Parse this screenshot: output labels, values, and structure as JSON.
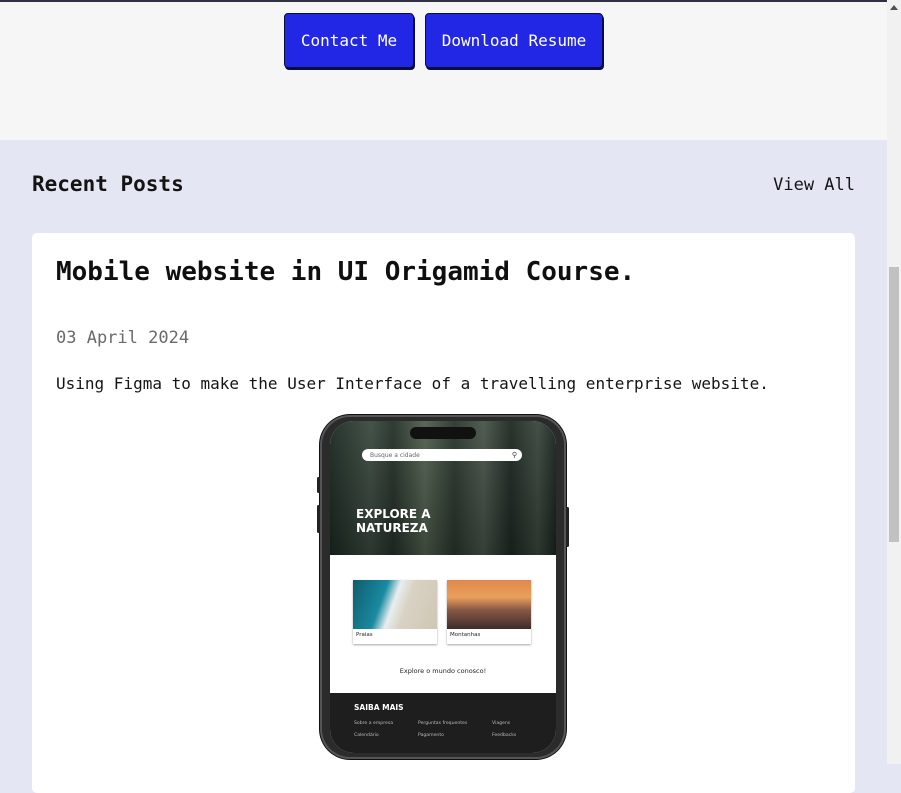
{
  "hero": {
    "contact_label": "Contact Me",
    "resume_label": "Download Resume"
  },
  "recent_posts": {
    "title": "Recent Posts",
    "view_all_label": "View All"
  },
  "post": {
    "title": "Mobile website in UI Origamid Course.",
    "date": "03 April 2024",
    "description": "Using Figma to make the User Interface of a travelling enterprise website.",
    "mockup": {
      "search_placeholder": "Busque a cidade",
      "hero_title": "EXPLORE A NATUREZA",
      "cards": [
        {
          "label": "Praias"
        },
        {
          "label": "Montanhas"
        }
      ],
      "cta": "Explore o mundo conosco!",
      "footer_title": "SAIBA MAIS",
      "footer_links": [
        "Sobre a empresa",
        "Perguntas frequentes",
        "Viagens",
        "Calendário",
        "Pagamento",
        "Feedbacks"
      ]
    }
  },
  "colors": {
    "accent": "#2127e4",
    "page_bg": "#e5e6f3",
    "hero_bg": "#f7f6f6"
  }
}
